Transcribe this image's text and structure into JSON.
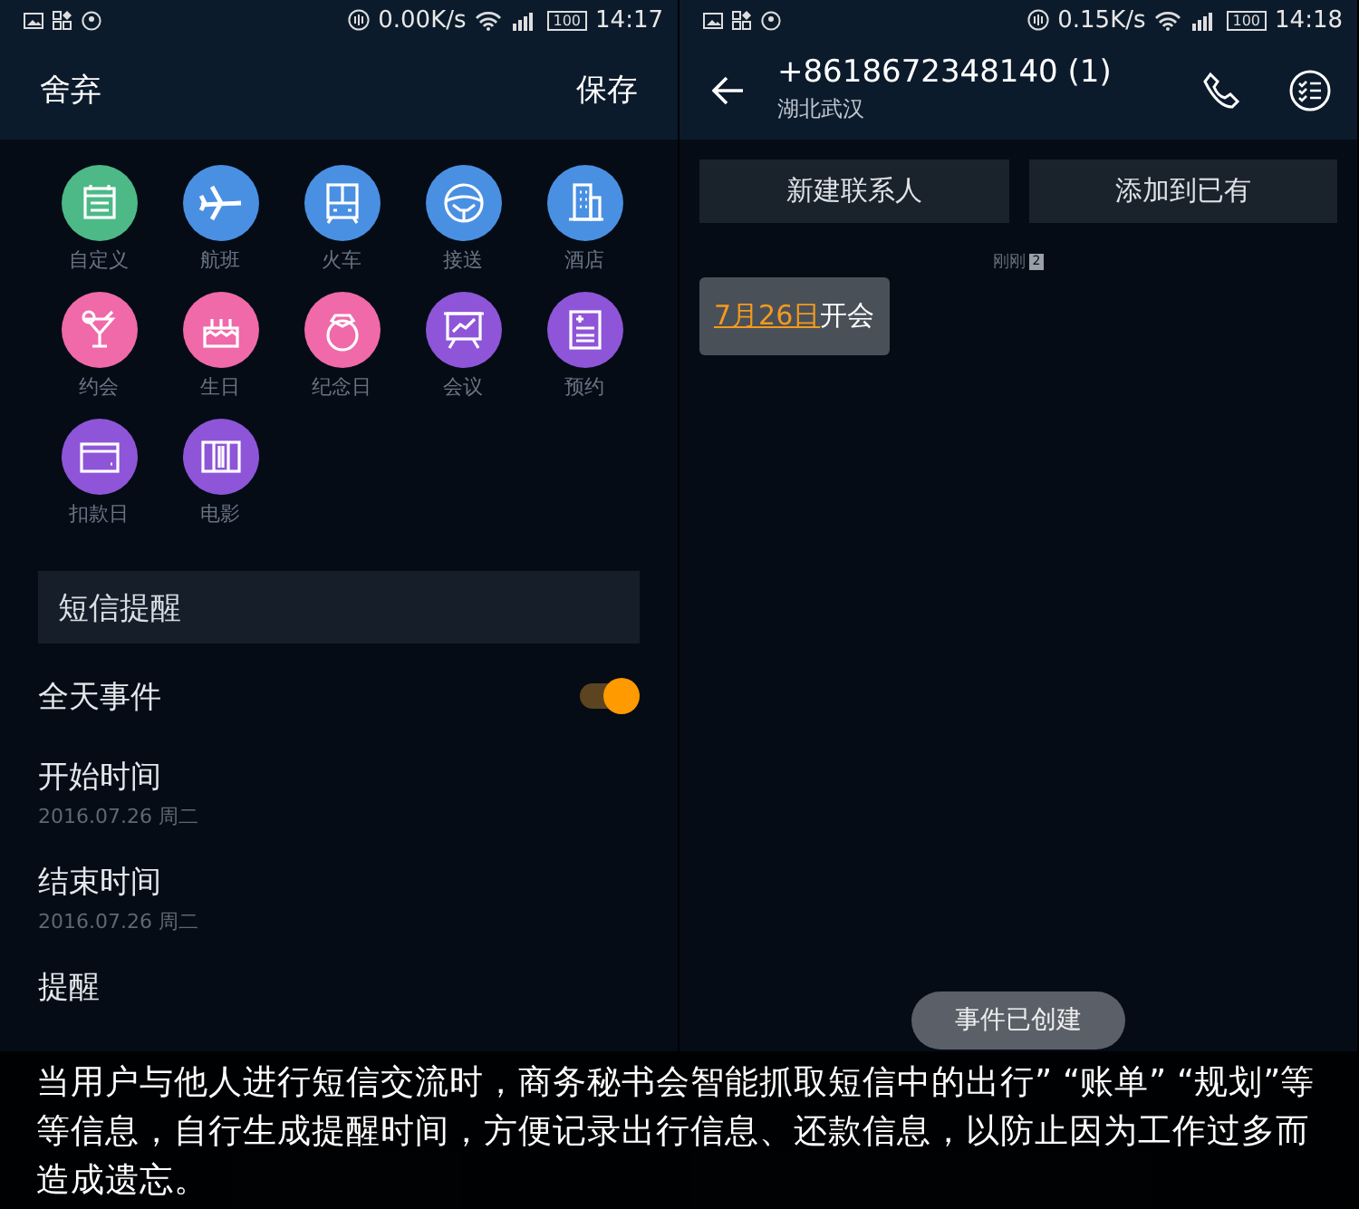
{
  "left_screen": {
    "status_bar": {
      "speed": "0.00K/s",
      "battery": "100",
      "time": "14:17"
    },
    "header": {
      "discard": "舍弃",
      "save": "保存"
    },
    "categories": [
      {
        "label": "自定义",
        "kind": "calendar",
        "color": "#4cb987"
      },
      {
        "label": "航班",
        "kind": "plane",
        "color": "#4a90e2"
      },
      {
        "label": "火车",
        "kind": "train",
        "color": "#4a90e2"
      },
      {
        "label": "接送",
        "kind": "wheel",
        "color": "#4a90e2"
      },
      {
        "label": "酒店",
        "kind": "building",
        "color": "#4a90e2"
      },
      {
        "label": "约会",
        "kind": "cocktail",
        "color": "#f069a9"
      },
      {
        "label": "生日",
        "kind": "cake",
        "color": "#f069a9"
      },
      {
        "label": "纪念日",
        "kind": "ring",
        "color": "#f069a9"
      },
      {
        "label": "会议",
        "kind": "board",
        "color": "#8e55d8"
      },
      {
        "label": "预约",
        "kind": "form",
        "color": "#8e55d8"
      },
      {
        "label": "扣款日",
        "kind": "card",
        "color": "#8e55d8"
      },
      {
        "label": "电影",
        "kind": "film",
        "color": "#8e55d8"
      }
    ],
    "title_field": "短信提醒",
    "all_day": {
      "label": "全天事件",
      "on": true
    },
    "rows": [
      {
        "label": "开始时间",
        "value": "2016.07.26 周二"
      },
      {
        "label": "结束时间",
        "value": "2016.07.26 周二"
      },
      {
        "label": "提醒"
      }
    ]
  },
  "right_screen": {
    "status_bar": {
      "speed": "0.15K/s",
      "battery": "100",
      "time": "14:18"
    },
    "header": {
      "number": "+8618672348140 (1)",
      "location": "湖北武汉"
    },
    "actions": [
      "新建联系人",
      "添加到已有"
    ],
    "timestamp": "刚刚",
    "sim": "2",
    "message": {
      "date_link": "7月26日",
      "text": "开会"
    },
    "toast": "事件已创建"
  },
  "caption": "当用户与他人进行短信交流时，商务秘书会智能抓取短信中的出行” “账单” “规划”等等信息，自行生成提醒时间，方便记录出行信息、还款信息，以防止因为工作过多而造成遗忘。"
}
